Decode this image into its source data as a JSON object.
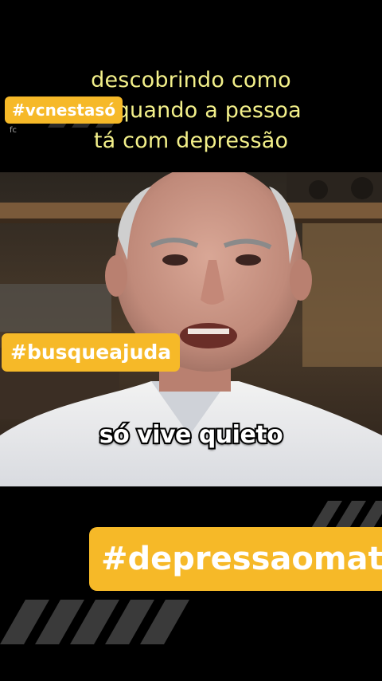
{
  "caption": {
    "line1": "descobrindo como",
    "line2": "ler quando a pessoa",
    "line3": "tá com depressão"
  },
  "hashtags": {
    "top_left": "#vcnestasó",
    "middle": "#busqueajuda",
    "bottom": "#depressaomata"
  },
  "subtitle": "só vive quieto",
  "faint_label": "fc",
  "colors": {
    "caption": "#f3f08a",
    "hashtag_bg": "#f6b928",
    "background": "#000000"
  }
}
